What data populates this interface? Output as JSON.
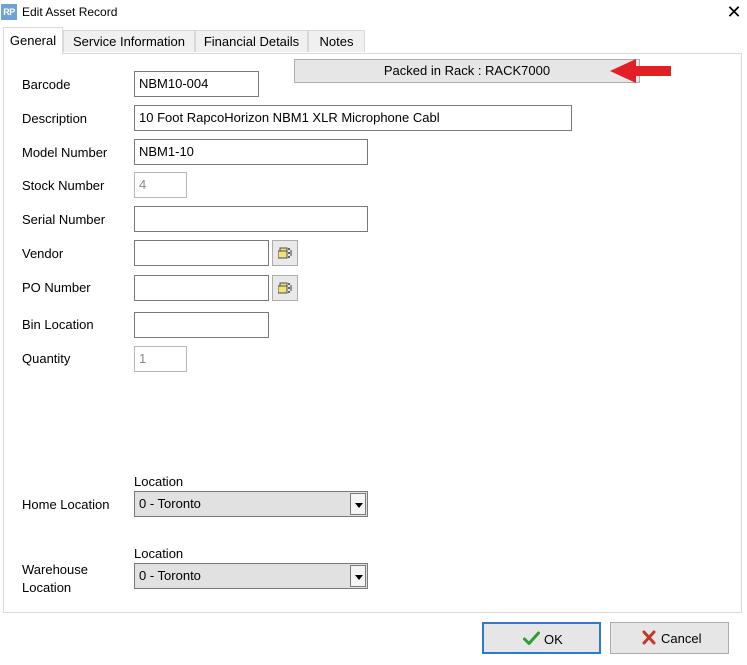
{
  "window": {
    "icon_text": "RP",
    "title": "Edit Asset Record",
    "close_glyph": "✕"
  },
  "tabs": [
    {
      "label": "General",
      "active": true
    },
    {
      "label": "Service Information",
      "active": false
    },
    {
      "label": "Financial Details",
      "active": false
    },
    {
      "label": "Notes",
      "active": false
    }
  ],
  "general": {
    "packed_in_rack": "Packed in Rack : RACK7000",
    "fields": {
      "barcode": {
        "label": "Barcode",
        "value": "NBM10-004"
      },
      "description": {
        "label": "Description",
        "value": "10 Foot RapcoHorizon NBM1 XLR Microphone Cabl"
      },
      "model_number": {
        "label": "Model Number",
        "value": "NBM1-10"
      },
      "stock_number": {
        "label": "Stock Number",
        "value": "4"
      },
      "serial_number": {
        "label": "Serial Number",
        "value": ""
      },
      "vendor": {
        "label": "Vendor",
        "value": ""
      },
      "po_number": {
        "label": "PO Number",
        "value": ""
      },
      "bin_location": {
        "label": "Bin Location",
        "value": ""
      },
      "quantity": {
        "label": "Quantity",
        "value": "1"
      }
    },
    "home_location": {
      "label": "Home Location",
      "caption": "Location",
      "selected": "0 - Toronto"
    },
    "warehouse_location": {
      "label_line1": "Warehouse",
      "label_line2": "Location",
      "caption": "Location",
      "selected": "0 - Toronto"
    }
  },
  "buttons": {
    "ok": "OK",
    "cancel": "Cancel"
  },
  "colors": {
    "arrow": "#e31e24",
    "ok_check": "#2e9e2e",
    "cancel_x": "#c0392b",
    "default_button_border": "#2b7bd1"
  }
}
